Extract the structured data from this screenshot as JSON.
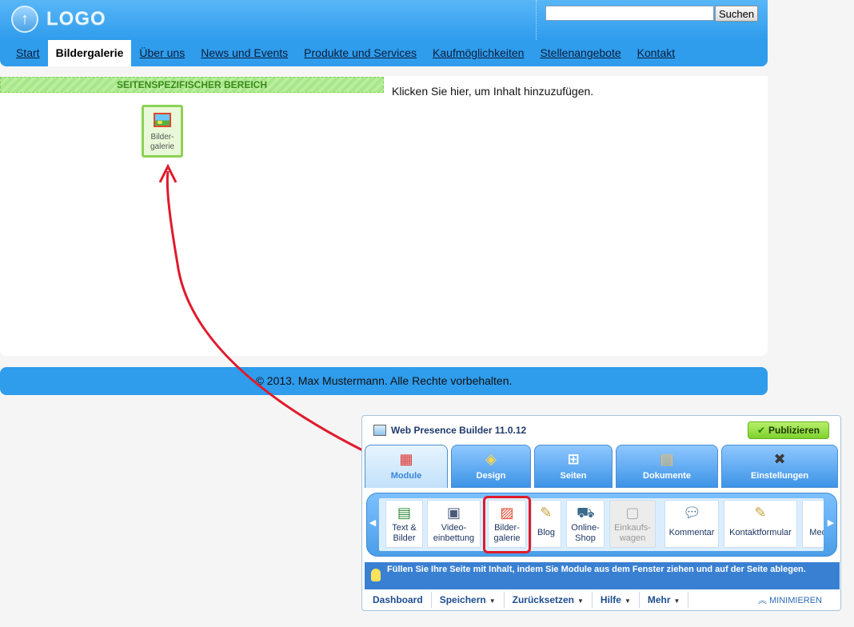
{
  "site": {
    "logo_glyph": "↑",
    "logo_text": "LOGO",
    "search": {
      "value": "",
      "button_label": "Suchen"
    },
    "nav": [
      {
        "label": "Start",
        "active": false
      },
      {
        "label": "Bildergalerie",
        "active": true
      },
      {
        "label": "Über uns",
        "active": false
      },
      {
        "label": "News und Events",
        "active": false
      },
      {
        "label": "Produkte und Services",
        "active": false
      },
      {
        "label": "Kaufmöglichkeiten",
        "active": false
      },
      {
        "label": "Stellenangebote",
        "active": false
      },
      {
        "label": "Kontakt",
        "active": false
      }
    ],
    "area_banner": "SEITENSPEZIFISCHER BEREICH",
    "add_content_hint": "Klicken Sie hier, um Inhalt hinzuzufügen.",
    "gallery_block_label": "Bilder-\ngalerie",
    "footer": "© 2013. Max Mustermann. Alle Rechte vorbehalten."
  },
  "builder": {
    "title": "Web Presence Builder 11.0.12",
    "publish_label": "Publizieren",
    "tabs": [
      {
        "label": "Module",
        "icon": "modules-icon",
        "active": true
      },
      {
        "label": "Design",
        "icon": "design-icon",
        "active": false
      },
      {
        "label": "Seiten",
        "icon": "pages-icon",
        "active": false
      },
      {
        "label": "Dokumente",
        "icon": "documents-icon",
        "active": false
      },
      {
        "label": "Einstellungen",
        "icon": "settings-icon",
        "active": false
      }
    ],
    "modules": [
      {
        "label": "Text &\nBilder",
        "icon": "text-image-icon",
        "disabled": false
      },
      {
        "label": "Video-\neinbettung",
        "icon": "video-icon",
        "disabled": false
      },
      {
        "label": "Bilder-\ngalerie",
        "icon": "gallery-icon",
        "disabled": false
      },
      {
        "label": "Blog",
        "icon": "blog-icon",
        "disabled": false
      },
      {
        "label": "Online-\nShop",
        "icon": "shop-icon",
        "disabled": false
      },
      {
        "label": "Einkaufs-\nwagen",
        "icon": "cart-icon",
        "disabled": true
      },
      {
        "label": "Kommentar",
        "icon": "comment-icon",
        "disabled": false
      },
      {
        "label": "Kontaktformular",
        "icon": "contact-form-icon",
        "disabled": false
      },
      {
        "label": "Med",
        "icon": "media-icon",
        "disabled": false
      }
    ],
    "hint": "Füllen Sie Ihre Seite mit Inhalt, indem Sie Module aus dem Fenster ziehen und auf der Seite ablegen.",
    "bottom_buttons": [
      {
        "label": "Dashboard",
        "dropdown": false
      },
      {
        "label": "Speichern",
        "dropdown": true
      },
      {
        "label": "Zurücksetzen",
        "dropdown": true
      },
      {
        "label": "Hilfe",
        "dropdown": true
      },
      {
        "label": "Mehr",
        "dropdown": true
      }
    ],
    "minimize_label": "MINIMIEREN",
    "colors": {
      "accent": "#2f9cec",
      "highlight": "#e01b2c",
      "publish": "#7fd12d"
    }
  }
}
